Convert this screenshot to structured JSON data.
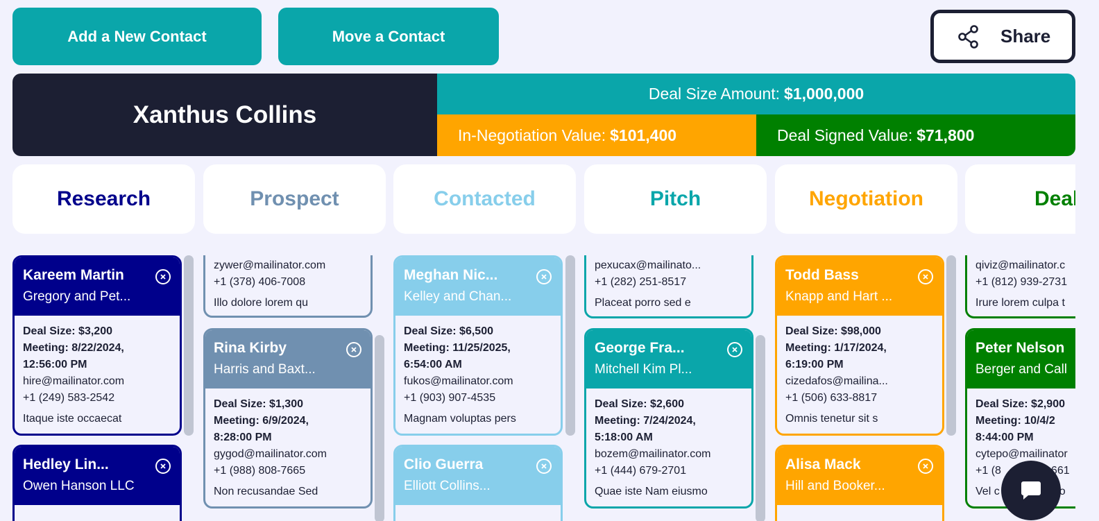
{
  "toolbar": {
    "add_label": "Add a New Contact",
    "move_label": "Move a Contact",
    "share_label": "Share"
  },
  "summary": {
    "owner": "Xanthus Collins",
    "deal_size_label": "Deal Size Amount:",
    "deal_size_value": "$1,000,000",
    "negotiation_label": "In-Negotiation Value:",
    "negotiation_value": "$101,400",
    "signed_label": "Deal Signed Value:",
    "signed_value": "$71,800"
  },
  "colors": {
    "teal": "#0aa6aa",
    "navy": "#00008b",
    "slate": "#7090b0",
    "sky": "#87ceeb",
    "orange": "#ffa500",
    "green": "#008000",
    "dark": "#1c1f33"
  },
  "stages": [
    {
      "label": "Research",
      "color": "#00008b"
    },
    {
      "label": "Prospect",
      "color": "#7090b0"
    },
    {
      "label": "Contacted",
      "color": "#87ceeb"
    },
    {
      "label": "Pitch",
      "color": "#0aa6aa"
    },
    {
      "label": "Negotiation",
      "color": "#ffa500"
    },
    {
      "label": "Deal",
      "color": "#008000"
    }
  ],
  "cards": {
    "research_1": {
      "name": "Kareem Martin",
      "company": "Gregory and Pet...",
      "deal_label": "Deal Size:",
      "deal": "$3,200",
      "meeting_label": "Meeting:",
      "meeting": "8/22/2024,",
      "meeting_time": "12:56:00 PM",
      "email": "hire@mailinator.com",
      "phone": "+1 (249) 583-2542",
      "notes": "Itaque iste occaecat"
    },
    "research_2": {
      "name": "Hedley Lin...",
      "company": "Owen Hanson LLC"
    },
    "prospect_1": {
      "email": "zywer@mailinator.com",
      "phone": "+1 (378) 406-7008",
      "notes": "Illo dolore lorem qu"
    },
    "prospect_2": {
      "name": "Rina Kirby",
      "company": "Harris and Baxt...",
      "deal_label": "Deal Size:",
      "deal": "$1,300",
      "meeting_label": "Meeting:",
      "meeting": "6/9/2024,",
      "meeting_time": "8:28:00 PM",
      "email": "gygod@mailinator.com",
      "phone": "+1 (988) 808-7665",
      "notes": "Non recusandae Sed"
    },
    "contacted_1": {
      "name": "Meghan Nic...",
      "company": "Kelley and Chan...",
      "deal_label": "Deal Size:",
      "deal": "$6,500",
      "meeting_label": "Meeting:",
      "meeting": "11/25/2025,",
      "meeting_time": "6:54:00 AM",
      "email": "fukos@mailinator.com",
      "phone": "+1 (903) 907-4535",
      "notes": "Magnam voluptas pers"
    },
    "contacted_2": {
      "name": "Clio Guerra",
      "company": "Elliott Collins..."
    },
    "pitch_1": {
      "email": "pexucax@mailinato...",
      "phone": "+1 (282) 251-8517",
      "notes": "Placeat porro sed e"
    },
    "pitch_2": {
      "name": "George Fra...",
      "company": "Mitchell Kim Pl...",
      "deal_label": "Deal Size:",
      "deal": "$2,600",
      "meeting_label": "Meeting:",
      "meeting": "7/24/2024,",
      "meeting_time": "5:18:00 AM",
      "email": "bozem@mailinator.com",
      "phone": "+1 (444) 679-2701",
      "notes": "Quae iste Nam eiusmo"
    },
    "negotiation_1": {
      "name": "Todd Bass",
      "company": "Knapp and Hart ...",
      "deal_label": "Deal Size:",
      "deal": "$98,000",
      "meeting_label": "Meeting:",
      "meeting": "1/17/2024,",
      "meeting_time": "6:19:00 PM",
      "email": "cizedafos@mailina...",
      "phone": "+1 (506) 633-8817",
      "notes": "Omnis tenetur sit s"
    },
    "negotiation_2": {
      "name": "Alisa Mack",
      "company": "Hill and Booker..."
    },
    "deal_1": {
      "email": "qiviz@mailinator.c",
      "phone": "+1 (812) 939-2731",
      "notes": "Irure lorem culpa t"
    },
    "deal_2": {
      "name": "Peter Nelson",
      "company": "Berger and Call",
      "deal_label": "Deal Size:",
      "deal": "$2,900",
      "meeting_label": "Meeting:",
      "meeting": "10/4/2",
      "meeting_time": "8:44:00 PM",
      "email": "cytepo@mailinator",
      "phone": "+1 (8",
      "phone_tail": "661",
      "notes": "Vel c",
      "notes_tail": "vo"
    }
  }
}
